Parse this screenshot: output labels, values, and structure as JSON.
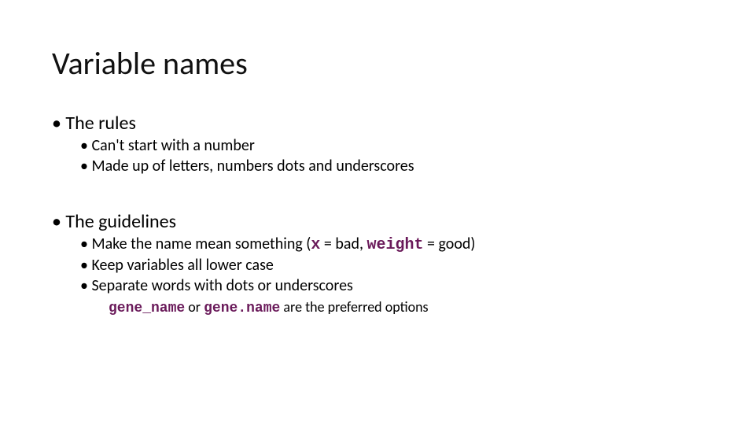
{
  "title": "Variable names",
  "sections": {
    "rules": {
      "heading": "The rules",
      "items": [
        "Can't start with a number",
        "Made up of letters, numbers dots and underscores"
      ]
    },
    "guidelines": {
      "heading": "The guidelines",
      "item1_pre": "Make the name mean something (",
      "item1_code1": "x",
      "item1_mid": " = bad, ",
      "item1_code2": "weight",
      "item1_post": " = good)",
      "item2": "Keep variables all lower case",
      "item3": "Separate words with dots or underscores",
      "note_code1": "gene_name",
      "note_mid1": " or ",
      "note_code2": "gene.name",
      "note_post": " are the preferred options"
    }
  }
}
